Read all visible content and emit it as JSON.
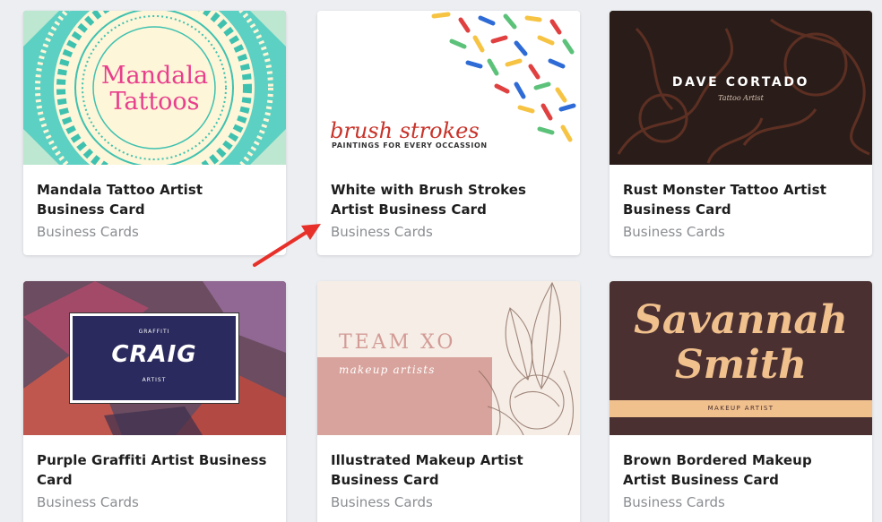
{
  "cards": [
    {
      "title": "Mandala Tattoo Artist Business Card",
      "category": "Business Cards",
      "preview": {
        "line1": "Mandala",
        "line2": "Tattoos"
      }
    },
    {
      "title": "White with Brush Strokes Artist Business Card",
      "category": "Business Cards",
      "preview": {
        "line1": "brush strokes",
        "line2": "PAINTINGS FOR EVERY OCCASSION"
      }
    },
    {
      "title": "Rust Monster Tattoo Artist Business Card",
      "category": "Business Cards",
      "preview": {
        "line1": "DAVE CORTADO",
        "line2": "Tattoo Artist"
      }
    },
    {
      "title": "Purple Graffiti Artist Business Card",
      "category": "Business Cards",
      "preview": {
        "top": "GRAFFITI",
        "name": "CRAIG",
        "bottom": "ARTIST"
      }
    },
    {
      "title": "Illustrated Makeup Artist Business Card",
      "category": "Business Cards",
      "preview": {
        "line1": "TEAM XO",
        "line2": "makeup artists"
      }
    },
    {
      "title": "Brown Bordered Makeup Artist Business Card",
      "category": "Business Cards",
      "preview": {
        "line1": "Savannah",
        "line2": "Smith",
        "line3": "MAKEUP ARTIST"
      }
    }
  ],
  "colors": {
    "page_bg": "#eceef1",
    "title": "#1e1e1e",
    "category": "#8a8d91",
    "annotation_arrow": "#e8302a"
  },
  "annotation": {
    "icon": "red-arrow-icon"
  }
}
